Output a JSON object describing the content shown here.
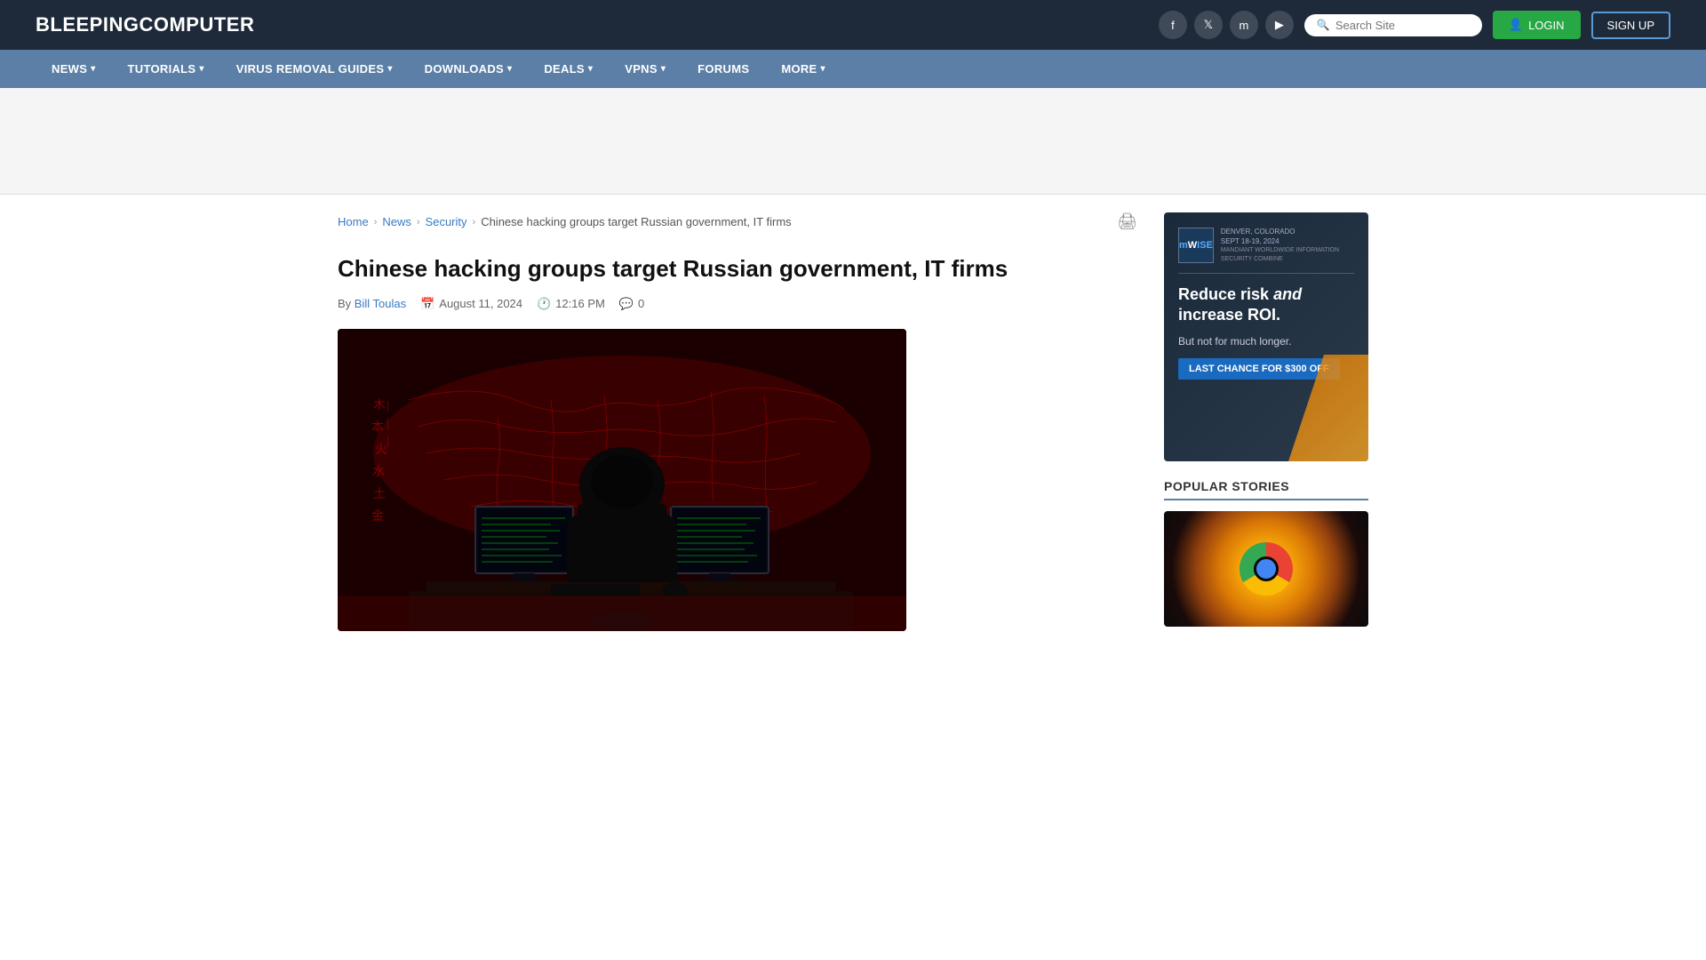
{
  "site": {
    "logo_plain": "BLEEPING",
    "logo_bold": "COMPUTER"
  },
  "header": {
    "search_placeholder": "Search Site",
    "login_label": "LOGIN",
    "signup_label": "SIGN UP",
    "social": [
      {
        "name": "facebook",
        "icon": "f"
      },
      {
        "name": "twitter",
        "icon": "𝕏"
      },
      {
        "name": "mastodon",
        "icon": "m"
      },
      {
        "name": "youtube",
        "icon": "▶"
      }
    ]
  },
  "nav": {
    "items": [
      {
        "label": "NEWS",
        "has_dropdown": true
      },
      {
        "label": "TUTORIALS",
        "has_dropdown": true
      },
      {
        "label": "VIRUS REMOVAL GUIDES",
        "has_dropdown": true
      },
      {
        "label": "DOWNLOADS",
        "has_dropdown": true
      },
      {
        "label": "DEALS",
        "has_dropdown": true
      },
      {
        "label": "VPNS",
        "has_dropdown": true
      },
      {
        "label": "FORUMS",
        "has_dropdown": false
      },
      {
        "label": "MORE",
        "has_dropdown": true
      }
    ]
  },
  "breadcrumb": {
    "home": "Home",
    "news": "News",
    "security": "Security",
    "current": "Chinese hacking groups target Russian government, IT firms"
  },
  "article": {
    "title": "Chinese hacking groups target Russian government, IT firms",
    "author_label": "By",
    "author_name": "Bill Toulas",
    "date": "August 11, 2024",
    "time": "12:16 PM",
    "comments": "0"
  },
  "sidebar_ad": {
    "logo_text": "mWISE",
    "org_name": "MANDIANT WORLDWIDE\nINFORMATION SECURITY COMBINE",
    "location": "DENVER, COLORADO\nSEPT 18-19, 2024",
    "headline_plain": "Reduce risk ",
    "headline_em": "and",
    "headline2": "increase ROI.",
    "sub_text": "But not for much longer.",
    "btn_label": "LAST CHANCE FOR $300 OFF"
  },
  "popular": {
    "title": "POPULAR STORIES"
  }
}
